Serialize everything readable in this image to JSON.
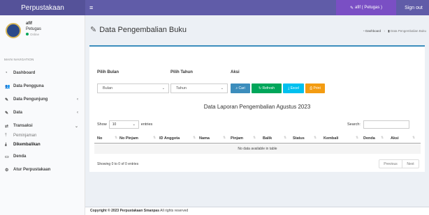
{
  "app": {
    "brand": "Perpustakaan",
    "menu_toggle": "≡"
  },
  "topbar": {
    "user_label": "afif ( Petugas )",
    "signout": "Sign out"
  },
  "sidebar": {
    "user": {
      "name": "afif",
      "role": "Petugas",
      "status": "Online"
    },
    "header": "MAIN NAVIGATION",
    "items": [
      {
        "label": "Dashboard",
        "icon": "dashboard-icon"
      },
      {
        "label": "Data Pengguna",
        "icon": "users-icon"
      },
      {
        "label": "Data Pengunjung",
        "icon": "edit-icon"
      },
      {
        "label": "Data",
        "icon": "edit-icon"
      },
      {
        "label": "Transaksi",
        "icon": "exchange-icon"
      },
      {
        "label": "Denda",
        "icon": "money-icon"
      },
      {
        "label": "Atur Perpustakaan",
        "icon": "gears-icon"
      }
    ],
    "sub_items": [
      {
        "label": "Peminjaman",
        "icon": "upload-icon"
      },
      {
        "label": "Dikembalikan",
        "icon": "download-icon"
      }
    ]
  },
  "page": {
    "title": "Data Pengembalian Buku",
    "breadcrumb": {
      "home": "Dashboard",
      "current": "Data Pengembalian Buku"
    }
  },
  "filters": {
    "month_label": "Pilih Bulan",
    "month_value": "Bulan",
    "year_label": "Pilih Tahun",
    "year_value": "Tahun",
    "action_label": "Aksi",
    "buttons": {
      "cari": "Cari",
      "refresh": "Refresh",
      "excel": "Excel",
      "print": "Print"
    }
  },
  "report": {
    "title": "Data Laporan Pengembalian Agustus 2023"
  },
  "table": {
    "show_label": "Show",
    "entries_value": "10",
    "entries_label": "entries",
    "search_label": "Search:",
    "columns": [
      "No",
      "No Pinjam",
      "ID Anggota",
      "Nama",
      "Pinjam",
      "Balik",
      "Status",
      "Kembali",
      "Denda",
      "Aksi"
    ],
    "empty_message": "No data available in table",
    "info": "Showing 0 to 0 of 0 entries",
    "prev": "Previous",
    "next": "Next"
  },
  "footer": {
    "copyright": "Copyright © 2023 Perpustakaan Smanpas",
    "rights": "All rights reserved"
  }
}
